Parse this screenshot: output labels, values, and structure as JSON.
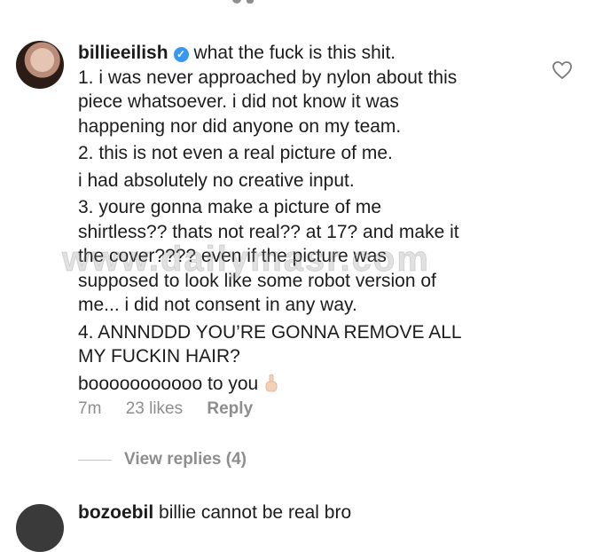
{
  "comment": {
    "username": "billieeilish",
    "lines": [
      "what the fuck is this shit.",
      "1. i was never approached by nylon about this",
      "piece whatsoever. i did not know it was",
      "happening nor did anyone on my team.",
      "2. this is not even a real picture of me.",
      "i had absolutely no creative input.",
      "3. youre gonna make a picture of me",
      "shirtless?? thats not real?? at 17? and make it",
      "the cover???? even if the picture was",
      "supposed to look like some robot version of",
      "me... i did not consent in any way.",
      "4. ANNNDDD YOU’RE GONNA REMOVE ALL",
      "MY FUCKIN HAIR?",
      "booooooooooo to you"
    ],
    "time": "7m",
    "likes": "23 likes",
    "reply": "Reply"
  },
  "view_replies": "View replies (4)",
  "next_comment": {
    "username": "bozoebil",
    "text": "billie cannot be real bro"
  },
  "watermark": "www.dailymasr.com",
  "icons": {
    "verified": "verified-badge-icon",
    "like": "heart-icon",
    "hand": "hand-emoji-icon"
  },
  "colors": {
    "verified": "#3897f0",
    "muted": "#8e8e8e",
    "text": "#1c1c1c"
  }
}
